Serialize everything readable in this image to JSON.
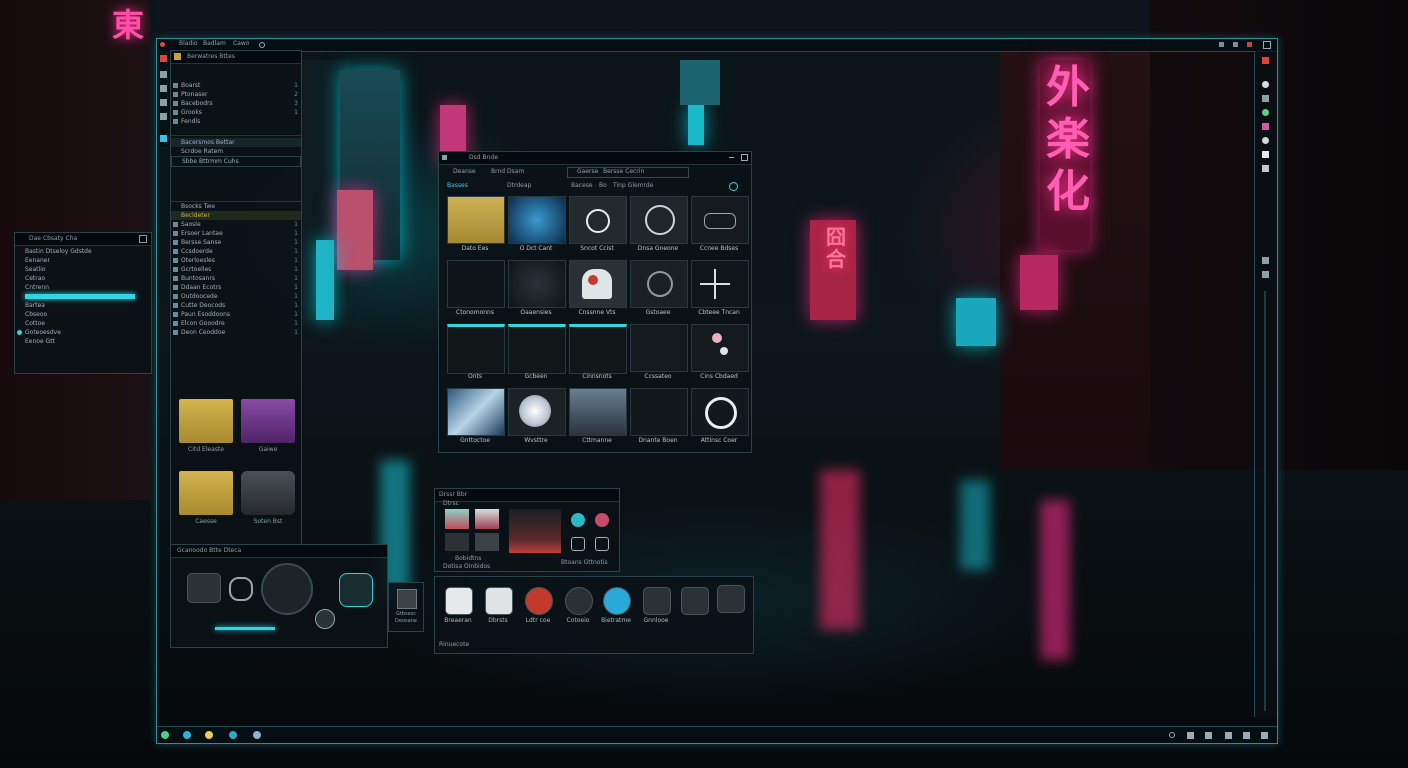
{
  "topbar": {
    "menu": [
      "Bladio",
      "Badlam",
      "Cawo"
    ],
    "icons": [
      "app-menu-icon",
      "grid-icon",
      "close-icon"
    ]
  },
  "left_panel": {
    "header": "Berwatres Bttes",
    "section1": [
      {
        "label": "Boarst",
        "value": "1"
      },
      {
        "label": "Ptonaser",
        "value": "2"
      },
      {
        "label": "Bacebodrs",
        "value": "3"
      },
      {
        "label": "Grooks",
        "value": "1"
      },
      {
        "label": "Fendls",
        "value": ""
      }
    ],
    "section2": [
      "Bacersmos Bettar",
      "Scrdoe Ratem",
      "Sbbe Bttrmm Cuhs"
    ],
    "section3_header": "Bsocks Twe",
    "section3_sub": "Becldeter",
    "list": [
      "Saosle",
      "Ersoer Lantae",
      "Bersse Sanse",
      "Ccsdoerde",
      "Oterloesles",
      "Gcrtoelles",
      "Buntosanrs",
      "Ddaan Ecotrs",
      "Outdoocede",
      "Cutte Deocods",
      "Paun Esoddoons",
      "Elcon Gooodre",
      "Deon Ceoddoe"
    ],
    "folders": [
      {
        "label": "Citd Eleaste",
        "color": "#c4a440"
      },
      {
        "label": "Gaiwe",
        "color": "#6e3a8c"
      },
      {
        "label": "Caesse",
        "color": "#c4a440"
      },
      {
        "label": "Soten Bst",
        "color": "#3a3f44"
      }
    ]
  },
  "small_window": {
    "title": "Dae Cbsaty Cha",
    "items": [
      "Bastin Dtseloy Gdstde",
      "Eenaner",
      "Seatlio",
      "Cetrao",
      "Cntrenn",
      "Bartea",
      "Cbseoo",
      "Cottoe",
      "Goteoesdve",
      "Eenoe Gtt"
    ]
  },
  "file_window": {
    "title": "Dsd Bnde",
    "path": [
      "Deanse",
      "Brnd Dsam",
      "Gaerse",
      "Bersse Cecrin"
    ],
    "toolbar": [
      "Basses",
      "Dtrdeap",
      "Bacese",
      "Bo",
      "Tinp Glemrde"
    ],
    "tiles": [
      {
        "label": "Dato Ees",
        "kind": "folder"
      },
      {
        "label": "O Dct Cant",
        "kind": "screen"
      },
      {
        "label": "Sncot Ccist",
        "kind": "line-art"
      },
      {
        "label": "Dnsa Gneone",
        "kind": "dial"
      },
      {
        "label": "Ccnee Bdses",
        "kind": "sketch"
      },
      {
        "label": "Ctonomonns",
        "kind": "dark"
      },
      {
        "label": "Oaaensies",
        "kind": "ring"
      },
      {
        "label": "Cnssnne Vts",
        "kind": "robot"
      },
      {
        "label": "Gstoaee",
        "kind": "speaker"
      },
      {
        "label": "Cbteee Tncan",
        "kind": "starburst"
      },
      {
        "label": "Onts",
        "kind": "dark-folder"
      },
      {
        "label": "Gcbeen",
        "kind": "dark-folder"
      },
      {
        "label": "Cinnsnots",
        "kind": "dark-folder"
      },
      {
        "label": "Ccssateo",
        "kind": "dark"
      },
      {
        "label": "Cins Cbdaed",
        "kind": "bubbles"
      },
      {
        "label": "Gnttoctoe",
        "kind": "glitch"
      },
      {
        "label": "Wvsttre",
        "kind": "orb"
      },
      {
        "label": "Cttmanne",
        "kind": "city"
      },
      {
        "label": "Dnante Boen",
        "kind": "dark"
      },
      {
        "label": "Attinsc Coer",
        "kind": "emblem"
      }
    ]
  },
  "media_window": {
    "title": "Drssr Bbr",
    "sub": "Dtrsc",
    "caption1": "Bobidtns",
    "caption2": "Dotisa Oinbidos",
    "caption3": "Btoans Gttnotis"
  },
  "dock": {
    "apps": [
      {
        "label": "Breaeran",
        "icon": "ship-icon"
      },
      {
        "label": "Dbrsts",
        "icon": "game-icon"
      },
      {
        "label": "Ldtr coe",
        "icon": "record-icon"
      },
      {
        "label": "Cotoeio",
        "icon": "target-icon"
      },
      {
        "label": "Bietratme",
        "icon": "bird-icon"
      },
      {
        "label": "Gnnlooe",
        "icon": "link-icon"
      }
    ],
    "footer": "Rinuecote"
  },
  "media_player": {
    "title": "Gcanoodo Btte Dteca",
    "side_caption": "Gtbsesc Deosane"
  },
  "colors": {
    "accent": "#2fd6e4",
    "neon_pink": "#ff2f8e",
    "folder": "#c4a440"
  }
}
